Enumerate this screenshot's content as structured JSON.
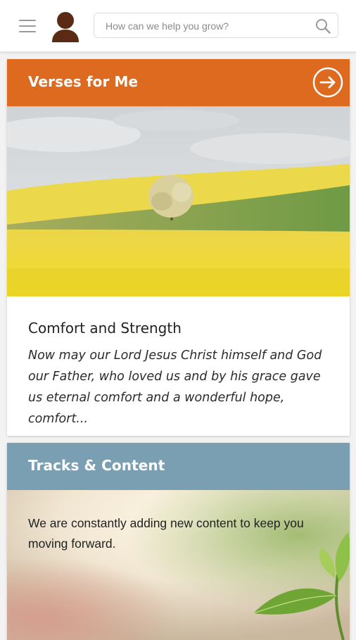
{
  "search": {
    "placeholder": "How can we help you grow?"
  },
  "icons": {
    "menu": "hamburger-icon",
    "avatar": "user-avatar-icon",
    "search": "search-icon",
    "arrow": "arrow-right-circle-icon"
  },
  "colors": {
    "verses_header": "#de6a1f",
    "tracks_header": "#7b9fb2",
    "avatar": "#5a2a14"
  },
  "verses_card": {
    "title": "Verses for Me",
    "verse_title": "Comfort and Strength",
    "verse_text": "Now may our Lord Jesus Christ himself and God our Father, who loved us and by his grace gave us eternal comfort and a wonderful hope, comfort..."
  },
  "tracks_card": {
    "title": "Tracks & Content",
    "description": "We are constantly adding new content to keep you moving forward."
  }
}
